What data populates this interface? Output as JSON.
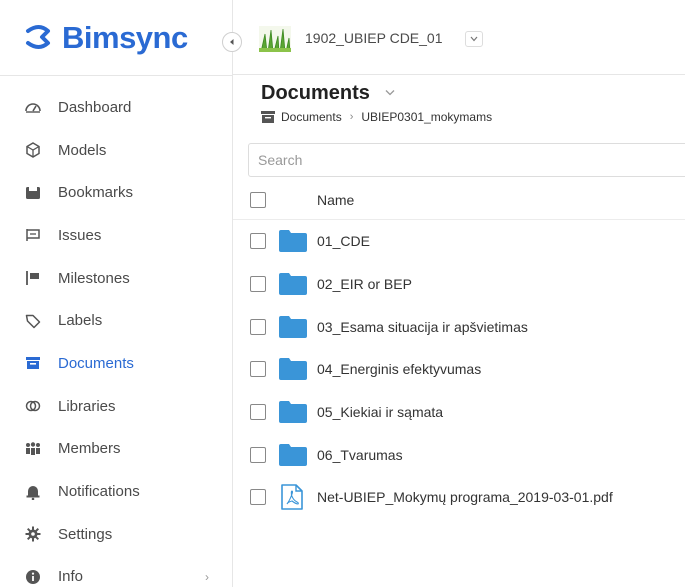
{
  "brand": {
    "name": "Bimsync",
    "color": "#2a6ad3"
  },
  "project": {
    "name": "1902_UBIEP CDE_01"
  },
  "sidebar": {
    "items": [
      {
        "label": "Dashboard",
        "icon": "dashboard-icon"
      },
      {
        "label": "Models",
        "icon": "cube-icon"
      },
      {
        "label": "Bookmarks",
        "icon": "bookmark-icon"
      },
      {
        "label": "Issues",
        "icon": "issues-icon"
      },
      {
        "label": "Milestones",
        "icon": "flag-icon"
      },
      {
        "label": "Labels",
        "icon": "tag-icon"
      },
      {
        "label": "Documents",
        "icon": "documents-icon",
        "active": true
      },
      {
        "label": "Libraries",
        "icon": "libraries-icon"
      },
      {
        "label": "Members",
        "icon": "members-icon"
      },
      {
        "label": "Notifications",
        "icon": "bell-icon"
      },
      {
        "label": "Settings",
        "icon": "gear-icon"
      },
      {
        "label": "Info",
        "icon": "info-icon",
        "chevron": "›"
      }
    ]
  },
  "main": {
    "title": "Documents",
    "breadcrumb": [
      "Documents",
      "UBIEP0301_mokymams"
    ],
    "search_placeholder": "Search",
    "column_name": "Name",
    "rows": [
      {
        "type": "folder",
        "name": "01_CDE"
      },
      {
        "type": "folder",
        "name": "02_EIR or BEP"
      },
      {
        "type": "folder",
        "name": "03_Esama situacija ir apšvietimas"
      },
      {
        "type": "folder",
        "name": "04_Energinis efektyvumas"
      },
      {
        "type": "folder",
        "name": "05_Kiekiai ir sąmata"
      },
      {
        "type": "folder",
        "name": "06_Tvarumas"
      },
      {
        "type": "pdf",
        "name": "Net-UBIEP_Mokymų programa_2019-03-01.pdf"
      }
    ],
    "folder_color": "#3a95d8"
  }
}
